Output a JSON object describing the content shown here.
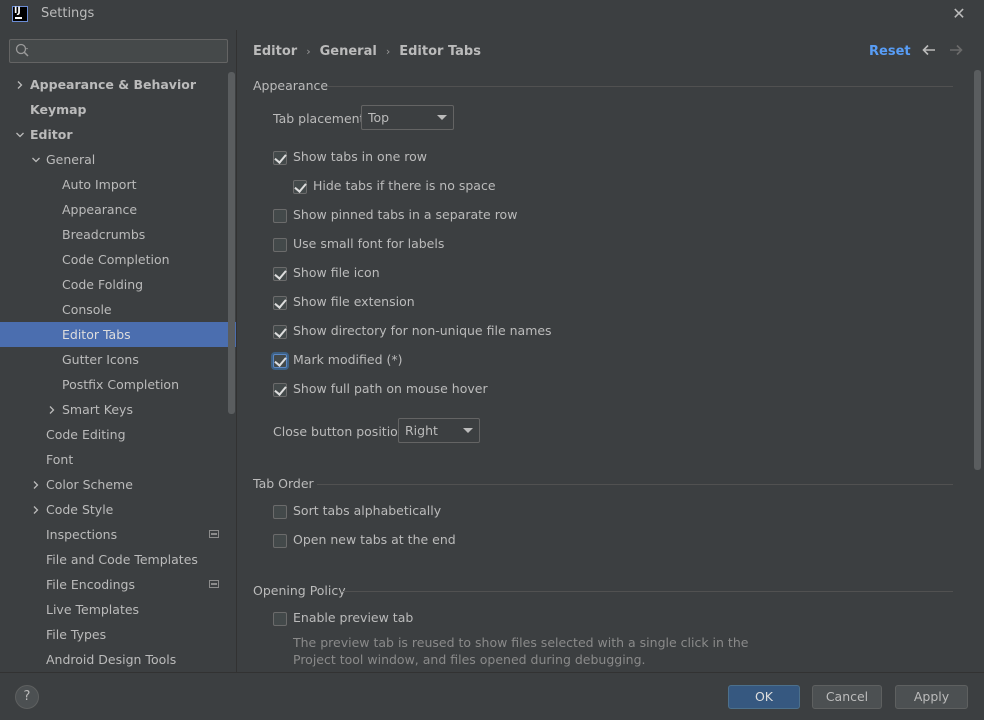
{
  "window": {
    "title": "Settings",
    "logo_text": "IJ"
  },
  "sidebar": {
    "search": {
      "placeholder": "",
      "value": ""
    },
    "items": [
      {
        "label": "Appearance & Behavior",
        "bold": true,
        "expandable": true,
        "expanded": false,
        "level": 0
      },
      {
        "label": "Keymap",
        "bold": true,
        "expandable": false,
        "level": 0
      },
      {
        "label": "Editor",
        "bold": true,
        "expandable": true,
        "expanded": true,
        "level": 0
      },
      {
        "label": "General",
        "expandable": true,
        "expanded": true,
        "level": 1
      },
      {
        "label": "Auto Import",
        "level": 2
      },
      {
        "label": "Appearance",
        "level": 2
      },
      {
        "label": "Breadcrumbs",
        "level": 2
      },
      {
        "label": "Code Completion",
        "level": 2
      },
      {
        "label": "Code Folding",
        "level": 2
      },
      {
        "label": "Console",
        "level": 2
      },
      {
        "label": "Editor Tabs",
        "level": 2,
        "selected": true
      },
      {
        "label": "Gutter Icons",
        "level": 2
      },
      {
        "label": "Postfix Completion",
        "level": 2
      },
      {
        "label": "Smart Keys",
        "level": 2,
        "expandable": true,
        "expanded": false
      },
      {
        "label": "Code Editing",
        "level": 1
      },
      {
        "label": "Font",
        "level": 1
      },
      {
        "label": "Color Scheme",
        "level": 1,
        "expandable": true,
        "expanded": false
      },
      {
        "label": "Code Style",
        "level": 1,
        "expandable": true,
        "expanded": false
      },
      {
        "label": "Inspections",
        "level": 1,
        "badge": true
      },
      {
        "label": "File and Code Templates",
        "level": 1
      },
      {
        "label": "File Encodings",
        "level": 1,
        "badge": true
      },
      {
        "label": "Live Templates",
        "level": 1
      },
      {
        "label": "File Types",
        "level": 1
      },
      {
        "label": "Android Design Tools",
        "level": 1
      }
    ]
  },
  "header": {
    "breadcrumb": [
      "Editor",
      "General",
      "Editor Tabs"
    ],
    "reset_label": "Reset",
    "back_icon": "arrow-left-icon",
    "forward_icon": "arrow-right-icon"
  },
  "appearance": {
    "title": "Appearance",
    "tab_placement_label": "Tab placement:",
    "tab_placement_value": "Top",
    "checkboxes": [
      {
        "label": "Show tabs in one row",
        "checked": true,
        "indent": 0
      },
      {
        "label": "Hide tabs if there is no space",
        "checked": true,
        "indent": 1
      },
      {
        "label": "Show pinned tabs in a separate row",
        "checked": false,
        "indent": 0
      },
      {
        "label": "Use small font for labels",
        "checked": false,
        "indent": 0
      },
      {
        "label": "Show file icon",
        "checked": true,
        "indent": 0
      },
      {
        "label": "Show file extension",
        "checked": true,
        "indent": 0
      },
      {
        "label": "Show directory for non-unique file names",
        "checked": true,
        "indent": 0
      },
      {
        "label": "Mark modified (*)",
        "checked": true,
        "indent": 0,
        "focused": true
      },
      {
        "label": "Show full path on mouse hover",
        "checked": true,
        "indent": 0
      }
    ],
    "close_button_label": "Close button position:",
    "close_button_value": "Right"
  },
  "tab_order": {
    "title": "Tab Order",
    "checkboxes": [
      {
        "label": "Sort tabs alphabetically",
        "checked": false
      },
      {
        "label": "Open new tabs at the end",
        "checked": false
      }
    ]
  },
  "opening_policy": {
    "title": "Opening Policy",
    "checkboxes": [
      {
        "label": "Enable preview tab",
        "checked": false
      }
    ],
    "help_text": "The preview tab is reused to show files selected with a single click in the Project tool window, and files opened during debugging."
  },
  "footer": {
    "help_label": "?",
    "ok_label": "OK",
    "cancel_label": "Cancel",
    "apply_label": "Apply"
  },
  "colors": {
    "background": "#3c3f41",
    "selection": "#4b6eaf",
    "link": "#589df6",
    "primary_button": "#365880"
  }
}
